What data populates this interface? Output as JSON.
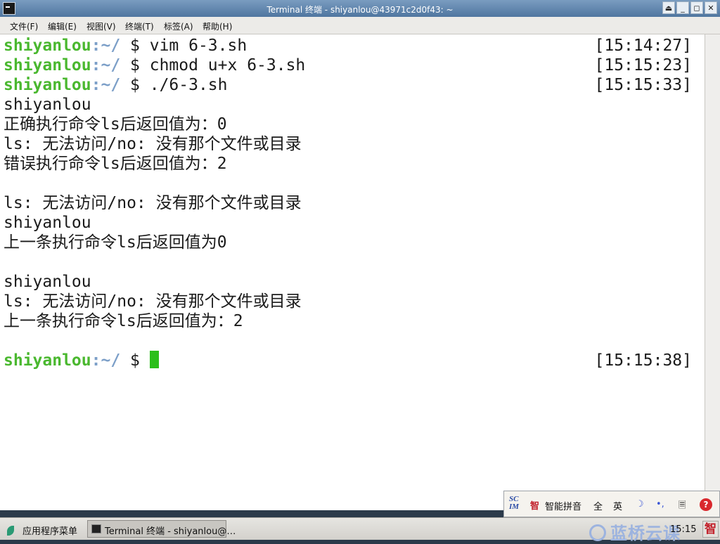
{
  "window": {
    "title": "Terminal 终端 - shiyanlou@43971c2d0f43: ~",
    "controls": [
      "⏏",
      "_",
      "◻",
      "✕"
    ]
  },
  "menubar": {
    "items": [
      "文件(F)",
      "编辑(E)",
      "视图(V)",
      "终端(T)",
      "标签(A)",
      "帮助(H)"
    ]
  },
  "terminal": {
    "prompt_user": "shiyanlou",
    "prompt_path": ":~/",
    "prompt_symbol": " $ ",
    "commands": [
      {
        "cmd": "vim 6-3.sh",
        "time": "[15:14:27]"
      },
      {
        "cmd": "chmod u+x 6-3.sh",
        "time": "[15:15:23]"
      },
      {
        "cmd": "./6-3.sh",
        "time": "[15:15:33]"
      }
    ],
    "output": [
      "shiyanlou",
      "正确执行命令ls后返回值为：0",
      "ls: 无法访问/no: 没有那个文件或目录",
      "错误执行命令ls后返回值为：2",
      "",
      "ls: 无法访问/no: 没有那个文件或目录",
      "shiyanlou",
      "上一条执行命令ls后返回值为0",
      "",
      "shiyanlou",
      "ls: 无法访问/no: 没有那个文件或目录",
      "上一条执行命令ls后返回值为：2",
      ""
    ],
    "current_prompt_time": "[15:15:38]"
  },
  "ime": {
    "logo_top": "SC",
    "logo_bottom": "IM",
    "brand": "智",
    "mode": "智能拼音",
    "full": "全",
    "lang": "英",
    "moon": "☽",
    "punct": "•,",
    "keyboard": "🗏",
    "help": "?"
  },
  "taskbar": {
    "start_label": "应用程序菜单",
    "task_label": "Terminal 终端 - shiyanlou@…",
    "watermark": "蓝桥云课",
    "clock": "15:15",
    "ime_indicator": "智"
  },
  "colors": {
    "prompt_user": "#4ab82f",
    "prompt_path": "#7c9fc8",
    "cursor": "#2bbf1a"
  }
}
